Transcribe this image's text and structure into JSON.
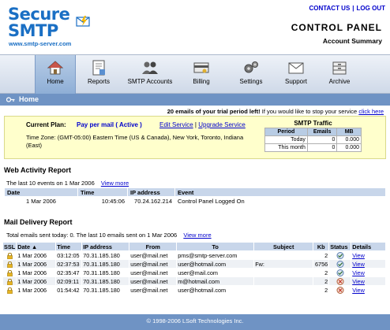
{
  "header": {
    "logo_line1": "Secure",
    "logo_line2": "SMTP",
    "logo_url": "www.smtp-server.com",
    "contact_link": "CONTACT US",
    "separator": "|",
    "logout_link": "LOG OUT",
    "title": "CONTROL PANEL",
    "subtitle": "Account Summary"
  },
  "nav": {
    "items": [
      {
        "label": "Home",
        "icon": "house-icon",
        "active": true
      },
      {
        "label": "Reports",
        "icon": "report-icon"
      },
      {
        "label": "SMTP Accounts",
        "icon": "users-icon"
      },
      {
        "label": "Billing",
        "icon": "billing-icon"
      },
      {
        "label": "Settings",
        "icon": "gears-icon"
      },
      {
        "label": "Support",
        "icon": "envelope-icon"
      },
      {
        "label": "Archive",
        "icon": "archive-icon"
      }
    ]
  },
  "homebar": {
    "title": "Home",
    "icon": "key-icon"
  },
  "trial": {
    "bold": "20 emails of your trial period left!",
    "text": " If you would like to stop your service ",
    "link": "click here"
  },
  "plan": {
    "label": "Current Plan:",
    "name": "Pay per mail ( Active )",
    "edit_link": "Edit Service",
    "sep": "|",
    "upgrade_link": "Upgrade Service",
    "timezone": "Time Zone: (GMT-05:00) Eastern Time (US & Canada), New York, Toronto, Indiana (East)",
    "traffic": {
      "caption": "SMTP Traffic",
      "headers": [
        "Period",
        "Emails",
        "MB"
      ],
      "rows": [
        [
          "Today",
          "0",
          "0.000"
        ],
        [
          "This month",
          "0",
          "0.000"
        ]
      ]
    }
  },
  "web_activity": {
    "title": "Web Activity Report",
    "sub": "The last 10 events on 1 Mar 2006",
    "view_more": "View more",
    "headers": [
      "Date",
      "Time",
      "IP address",
      "Event"
    ],
    "rows": [
      [
        "1 Mar 2006",
        "10:45:06",
        "70.24.162.214",
        "Control Panel Logged On"
      ]
    ]
  },
  "mail_delivery": {
    "title": "Mail Delivery Report",
    "sub": "Total emails sent today: 0. The last 10 emails sent on 1 Mar 2006",
    "view_more": "View more",
    "headers": [
      "SSL",
      "Date ▲",
      "Time",
      "IP address",
      "From",
      "To",
      "Subject",
      "Kb",
      "Status",
      "Details"
    ],
    "rows": [
      {
        "date": "1 Mar 2006",
        "time": "03:12:05",
        "ip": "70.31.185.180",
        "from": "user@mail.net",
        "to": "pms@smtp-server.com",
        "subject": "",
        "kb": "2",
        "status": "delivered",
        "details": "View"
      },
      {
        "date": "1 Mar 2006",
        "time": "02:37:53",
        "ip": "70.31.185.180",
        "from": "user@mail.net",
        "to": "user@hotmail.com",
        "subject": "Fw:",
        "kb": "6756",
        "status": "delivered",
        "details": "View"
      },
      {
        "date": "1 Mar 2006",
        "time": "02:35:47",
        "ip": "70.31.185.180",
        "from": "user@mail.net",
        "to": "user@mail.com",
        "subject": "",
        "kb": "2",
        "status": "delivered",
        "details": "View"
      },
      {
        "date": "1 Mar 2006",
        "time": "02:09:11",
        "ip": "70.31.185.180",
        "from": "user@mail.net",
        "to": "m@hotmail.com",
        "subject": "",
        "kb": "2",
        "status": "failed",
        "details": "View"
      },
      {
        "date": "1 Mar 2006",
        "time": "01:54:42",
        "ip": "70.31.185.180",
        "from": "user@mail.net",
        "to": "user@hotmail.com",
        "subject": "",
        "kb": "2",
        "status": "failed",
        "details": "View"
      }
    ]
  },
  "footer": {
    "text": "© 1998-2006 LSoft Technologies Inc."
  },
  "colors": {
    "brand": "#1a6fc4",
    "bar": "#6f93c4",
    "header_cell": "#c8d6ea",
    "plan_bg": "#ffffcc"
  }
}
